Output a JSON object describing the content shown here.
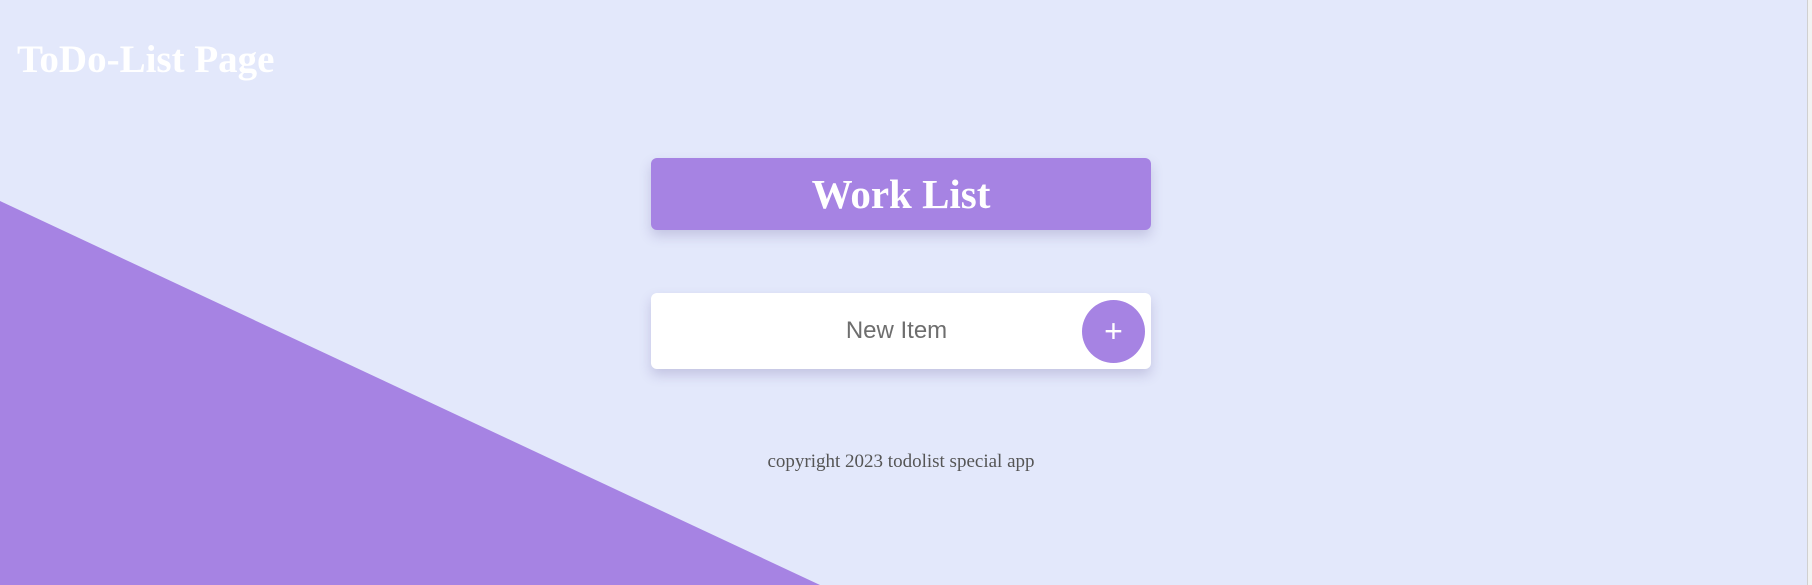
{
  "page": {
    "title": "ToDo-List Page"
  },
  "list": {
    "title": "Work List"
  },
  "new_item": {
    "placeholder": "New Item",
    "value": "",
    "add_button_label": "+"
  },
  "footer": {
    "text": "copyright 2023 todolist special app"
  },
  "colors": {
    "background": "#E3E8FB",
    "accent": "#A683E3",
    "card": "#FFFFFF",
    "title_text": "#FFFFFF",
    "muted_text": "#6E6E6E"
  },
  "icons": {
    "add": "plus-icon"
  }
}
